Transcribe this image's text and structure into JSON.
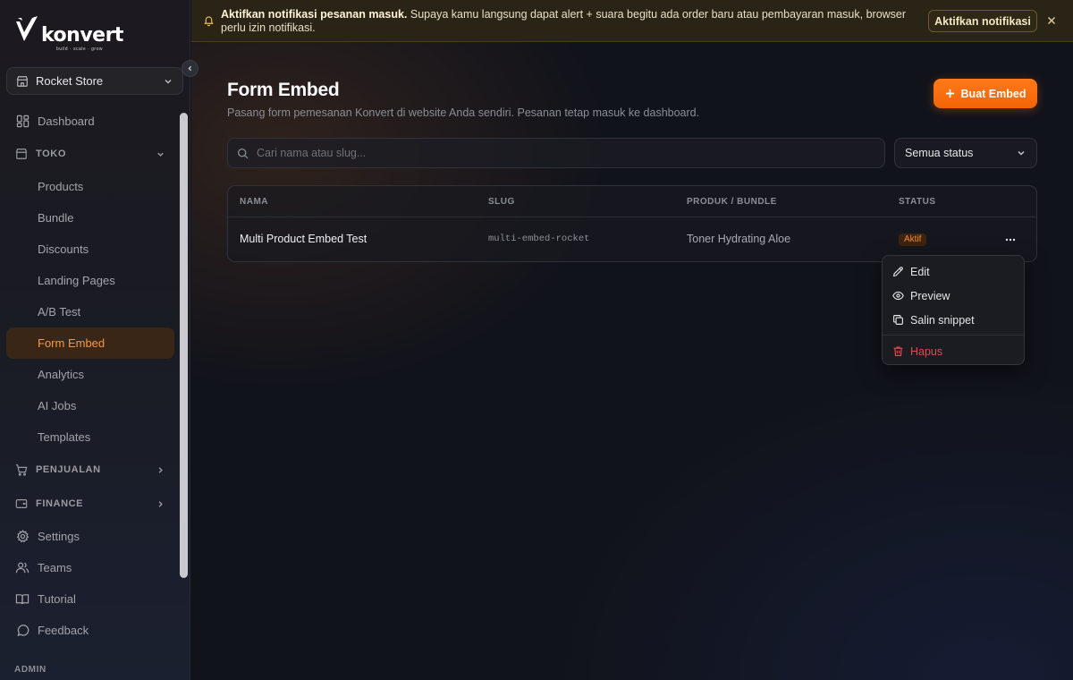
{
  "brand": {
    "name": "konvert",
    "tagline": "build · scale · grow"
  },
  "store": {
    "name": "Rocket Store"
  },
  "sidebar": {
    "dashboard": "Dashboard",
    "toko": {
      "label": "TOKO",
      "items": [
        "Products",
        "Bundle",
        "Discounts",
        "Landing Pages",
        "A/B Test",
        "Form Embed",
        "Analytics",
        "AI Jobs",
        "Templates"
      ],
      "active": "Form Embed"
    },
    "penjualan": "PENJUALAN",
    "finance": "FINANCE",
    "bottom": [
      "Settings",
      "Teams",
      "Tutorial",
      "Feedback"
    ],
    "admin": "ADMIN"
  },
  "banner": {
    "bold": "Aktifkan notifikasi pesanan masuk.",
    "text": " Supaya kamu langsung dapat alert + suara begitu ada order baru atau pembayaran masuk, browser perlu izin notifikasi.",
    "button": "Aktifkan notifikasi"
  },
  "page": {
    "title": "Form Embed",
    "subtitle": "Pasang form pemesanan Konvert di website Anda sendiri. Pesanan tetap masuk ke dashboard.",
    "create_button": "Buat Embed"
  },
  "filters": {
    "search_placeholder": "Cari nama atau slug...",
    "status": "Semua status"
  },
  "table": {
    "headers": {
      "name": "NAMA",
      "slug": "SLUG",
      "product": "PRODUK / BUNDLE",
      "status": "STATUS"
    },
    "rows": [
      {
        "name": "Multi Product Embed Test",
        "slug": "multi-embed-rocket",
        "product": "Toner Hydrating Aloe",
        "status": "Aktif"
      }
    ]
  },
  "row_menu": {
    "edit": "Edit",
    "preview": "Preview",
    "copy": "Salin snippet",
    "delete": "Hapus"
  },
  "colors": {
    "accent": "#f97316",
    "active_text": "#f59a3c",
    "danger": "#e5484d",
    "banner_bg": "#2a2416"
  }
}
